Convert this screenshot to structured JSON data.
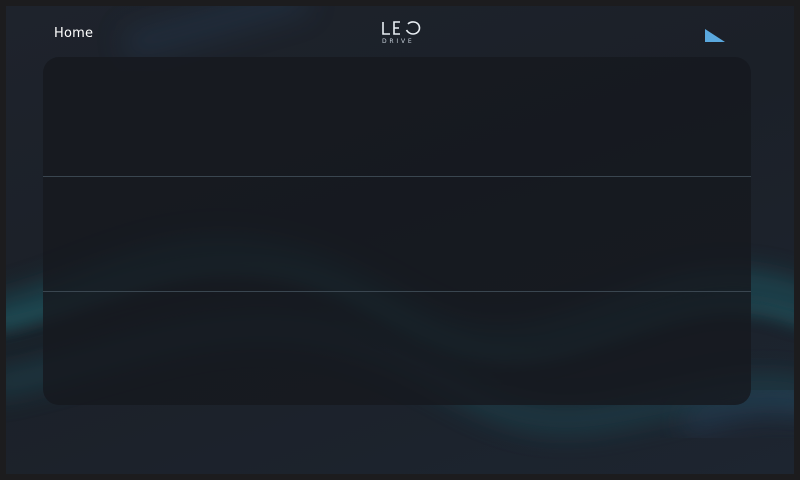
{
  "header": {
    "home_label": "Home",
    "logo": {
      "wordmark": "LEO",
      "subtitle": "DRIVE"
    },
    "status_icon": "signal-strength-icon"
  },
  "panel": {
    "rows": [
      {
        "label": ""
      },
      {
        "label": ""
      },
      {
        "label": ""
      }
    ]
  },
  "colors": {
    "background": "#1b2028",
    "panel": "#16191f",
    "divider": "#3a4650",
    "accent": "#5aa8de",
    "wave_teal": "#1f6f78"
  }
}
